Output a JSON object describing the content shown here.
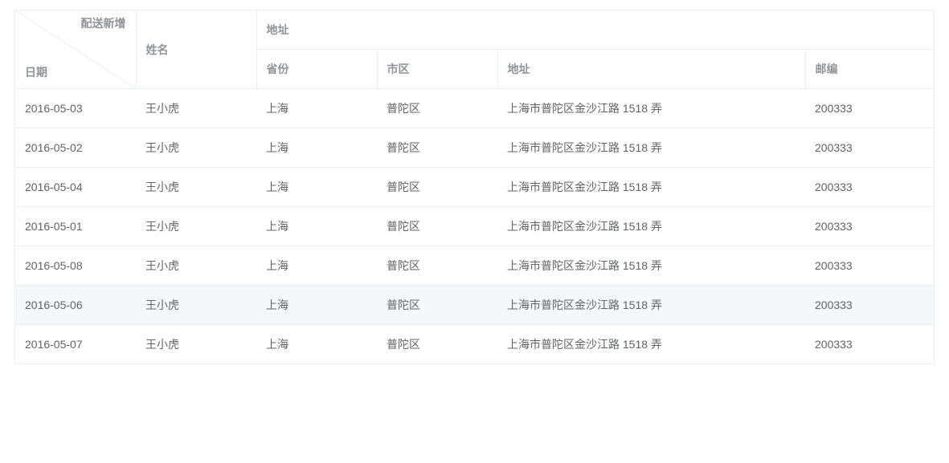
{
  "table": {
    "headers": {
      "diag_top_right": "配送新增",
      "diag_bottom_left": "日期",
      "name": "姓名",
      "address_group": "地址",
      "province": "省份",
      "city": "市区",
      "address": "地址",
      "zip": "邮编"
    },
    "rows": [
      {
        "date": "2016-05-03",
        "name": "王小虎",
        "province": "上海",
        "city": "普陀区",
        "address": "上海市普陀区金沙江路 1518 弄",
        "zip": "200333",
        "hover": false
      },
      {
        "date": "2016-05-02",
        "name": "王小虎",
        "province": "上海",
        "city": "普陀区",
        "address": "上海市普陀区金沙江路 1518 弄",
        "zip": "200333",
        "hover": false
      },
      {
        "date": "2016-05-04",
        "name": "王小虎",
        "province": "上海",
        "city": "普陀区",
        "address": "上海市普陀区金沙江路 1518 弄",
        "zip": "200333",
        "hover": false
      },
      {
        "date": "2016-05-01",
        "name": "王小虎",
        "province": "上海",
        "city": "普陀区",
        "address": "上海市普陀区金沙江路 1518 弄",
        "zip": "200333",
        "hover": false
      },
      {
        "date": "2016-05-08",
        "name": "王小虎",
        "province": "上海",
        "city": "普陀区",
        "address": "上海市普陀区金沙江路 1518 弄",
        "zip": "200333",
        "hover": false
      },
      {
        "date": "2016-05-06",
        "name": "王小虎",
        "province": "上海",
        "city": "普陀区",
        "address": "上海市普陀区金沙江路 1518 弄",
        "zip": "200333",
        "hover": true
      },
      {
        "date": "2016-05-07",
        "name": "王小虎",
        "province": "上海",
        "city": "普陀区",
        "address": "上海市普陀区金沙江路 1518 弄",
        "zip": "200333",
        "hover": false
      }
    ]
  }
}
